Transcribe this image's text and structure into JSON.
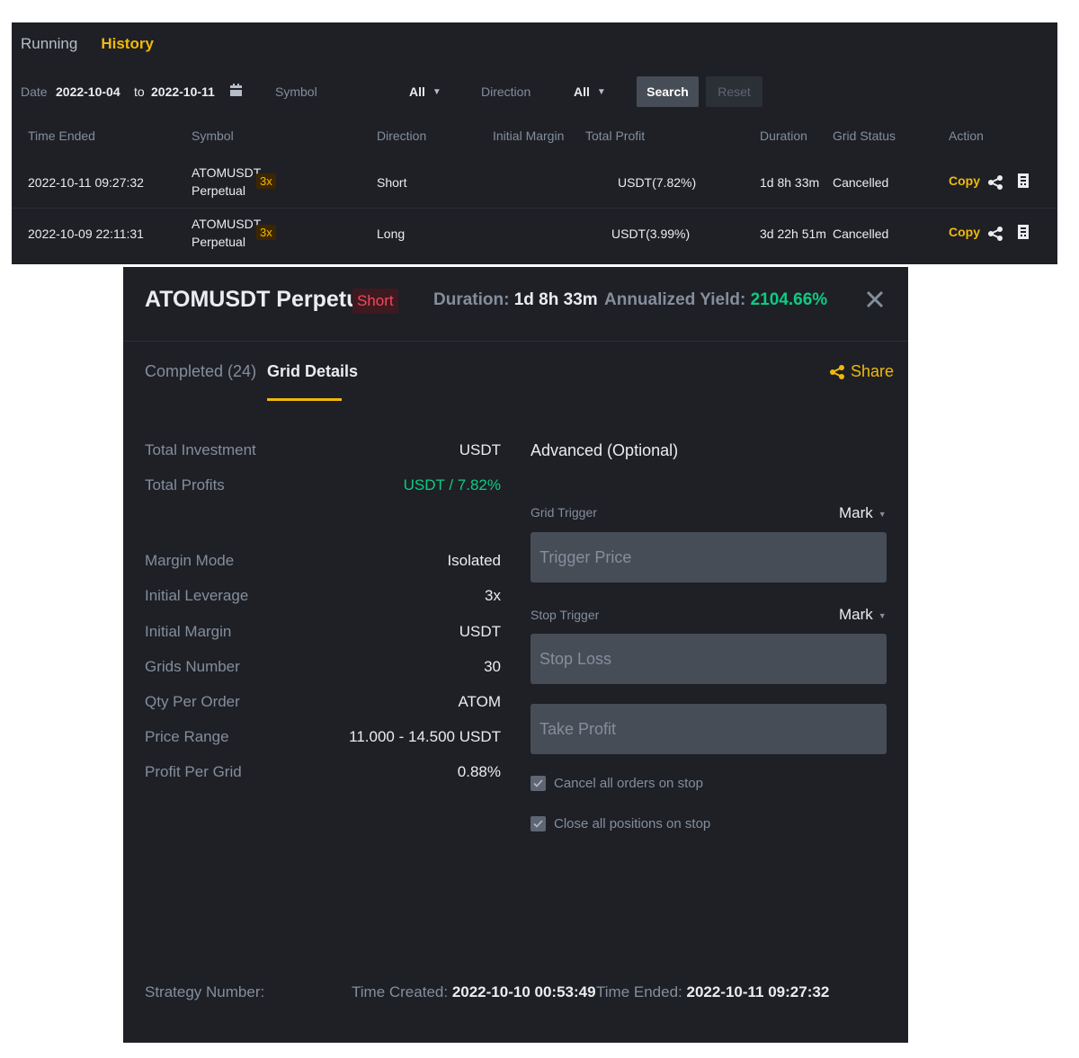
{
  "history": {
    "tabs": [
      {
        "label": "Running"
      },
      {
        "label": "History"
      }
    ],
    "filters": {
      "date_label": "Date",
      "date_from": "2022-10-04",
      "date_to_label": "to",
      "date_to": "2022-10-11",
      "symbol_label": "Symbol",
      "symbol_value": "All",
      "direction_label": "Direction",
      "direction_value": "All",
      "search_label": "Search",
      "reset_label": "Reset"
    },
    "columns": [
      "Time Ended",
      "Symbol",
      "Direction",
      "Initial Margin",
      "Total Profit",
      "Duration",
      "Grid Status",
      "Action"
    ],
    "rows": [
      {
        "time_ended": "2022-10-11 09:27:32",
        "symbol": "ATOMUSDT",
        "contract": "Perpetual",
        "leverage": "3x",
        "direction": "Short",
        "initial_margin": "",
        "total_profit": "USDT(7.82%)",
        "duration": "1d 8h 33m",
        "status": "Cancelled",
        "action": "Copy"
      },
      {
        "time_ended": "2022-10-09 22:11:31",
        "symbol": "ATOMUSDT",
        "contract": "Perpetual",
        "leverage": "3x",
        "direction": "Long",
        "initial_margin": "",
        "total_profit": "USDT(3.99%)",
        "duration": "3d 22h 51m",
        "status": "Cancelled",
        "action": "Copy"
      }
    ]
  },
  "modal": {
    "title": "ATOMUSDT Perpetual",
    "side": "Short",
    "duration_label": "Duration:",
    "duration_value": "1d 8h 33m",
    "yield_label": "Annualized Yield:",
    "yield_value": "2104.66%",
    "tabs": [
      {
        "label": "Completed (24)"
      },
      {
        "label": "Grid Details"
      }
    ],
    "share_label": "Share",
    "details": [
      {
        "label": "Total Investment",
        "value": "USDT"
      },
      {
        "label": "Total Profits",
        "value": "USDT / 7.82%"
      },
      {
        "label": "Margin Mode",
        "value": "Isolated"
      },
      {
        "label": "Initial Leverage",
        "value": "3x"
      },
      {
        "label": "Initial Margin",
        "value": "USDT"
      },
      {
        "label": "Grids Number",
        "value": "30"
      },
      {
        "label": "Qty Per Order",
        "value": "ATOM"
      },
      {
        "label": "Price Range",
        "value": "11.000 - 14.500 USDT"
      },
      {
        "label": "Profit Per Grid",
        "value": "0.88%"
      }
    ],
    "advanced": {
      "title": "Advanced (Optional)",
      "grid_trigger_label": "Grid Trigger",
      "grid_trigger_type": "Mark",
      "trigger_price_placeholder": "Trigger Price",
      "stop_trigger_label": "Stop Trigger",
      "stop_trigger_type": "Mark",
      "stop_loss_placeholder": "Stop Loss",
      "take_profit_placeholder": "Take Profit",
      "cancel_orders_label": "Cancel all orders on stop",
      "close_positions_label": "Close all positions on stop"
    },
    "footer": {
      "strategy_label": "Strategy Number:",
      "created_label": "Time Created:",
      "created_value": "2022-10-10 00:53:49",
      "ended_label": "Time Ended:",
      "ended_value": "2022-10-11 09:27:32"
    }
  },
  "colors": {
    "background": "#1e2026",
    "accent": "#f0b90b",
    "positive": "#0ecb81",
    "negative": "#f6465d",
    "muted_text": "#848e9c"
  }
}
